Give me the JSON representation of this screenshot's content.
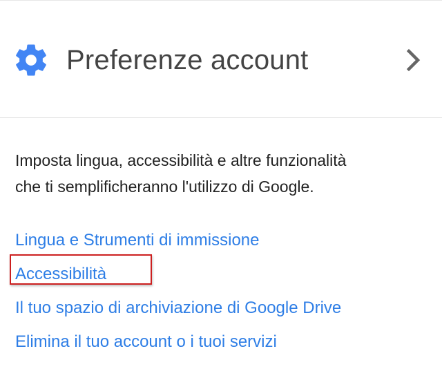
{
  "header": {
    "title": "Preferenze account",
    "icon": "gear-icon",
    "icon_color": "#4285f4",
    "chevron": "chevron-right-icon"
  },
  "description": {
    "line1": "Imposta lingua, accessibilità e altre funzionalità",
    "line2": "che ti semplificheranno l'utilizzo di Google."
  },
  "links": [
    {
      "label": "Lingua e Strumenti di immissione"
    },
    {
      "label": "Accessibilità",
      "highlighted": true
    },
    {
      "label": "Il tuo spazio di archiviazione di Google Drive"
    },
    {
      "label": "Elimina il tuo account o i tuoi servizi"
    }
  ],
  "colors": {
    "link": "#2e7ee6",
    "highlight_border": "#cc1f1f"
  }
}
